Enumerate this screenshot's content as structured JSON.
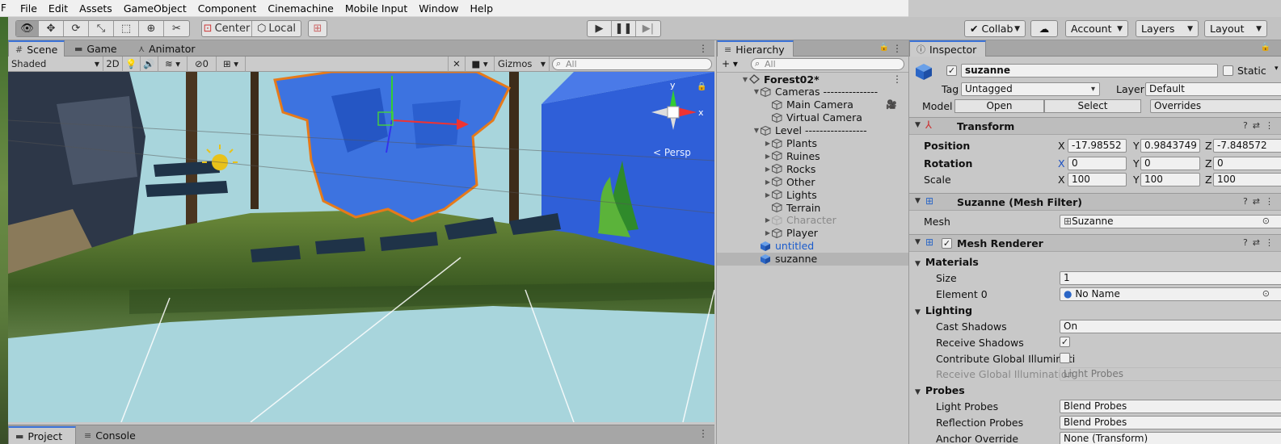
{
  "menu": {
    "leading_char": "F",
    "items": [
      "File",
      "Edit",
      "Assets",
      "GameObject",
      "Component",
      "Cinemachine",
      "Mobile Input",
      "Window",
      "Help"
    ]
  },
  "toolbar": {
    "center_label": "Center",
    "local_label": "Local",
    "collab_label": "Collab",
    "account_label": "Account",
    "layers_label": "Layers",
    "layout_label": "Layout"
  },
  "scene_tabs": {
    "scene": "Scene",
    "game": "Game",
    "animator": "Animator"
  },
  "scene_bar": {
    "shading": "Shaded",
    "mode_2d": "2D",
    "hidden_count": "0",
    "gizmos": "Gizmos",
    "search_placeholder": "All"
  },
  "viewport": {
    "gizmo_y": "y",
    "gizmo_x": "x",
    "persp_label": "< Persp"
  },
  "bottom_tabs": {
    "project": "Project",
    "console": "Console"
  },
  "hierarchy": {
    "tab_title": "Hierarchy",
    "add_label": "+ ▾",
    "search_placeholder": "All",
    "rows": [
      {
        "label": "Forest02*",
        "depth": 0,
        "arrow": "▼",
        "style": "bold"
      },
      {
        "label": "Cameras ---------------",
        "depth": 1,
        "arrow": "▼",
        "style": ""
      },
      {
        "label": "Main Camera",
        "depth": 2,
        "arrow": "",
        "style": ""
      },
      {
        "label": "Virtual Camera",
        "depth": 2,
        "arrow": "",
        "style": ""
      },
      {
        "label": "Level -----------------",
        "depth": 1,
        "arrow": "▼",
        "style": ""
      },
      {
        "label": "Plants",
        "depth": 2,
        "arrow": "▶",
        "style": ""
      },
      {
        "label": "Ruines",
        "depth": 2,
        "arrow": "▶",
        "style": ""
      },
      {
        "label": "Rocks",
        "depth": 2,
        "arrow": "▶",
        "style": ""
      },
      {
        "label": "Other",
        "depth": 2,
        "arrow": "▶",
        "style": ""
      },
      {
        "label": "Lights",
        "depth": 2,
        "arrow": "▶",
        "style": ""
      },
      {
        "label": "Terrain",
        "depth": 2,
        "arrow": "",
        "style": ""
      },
      {
        "label": "Character",
        "depth": 2,
        "arrow": "▶",
        "style": "dim"
      },
      {
        "label": "Player",
        "depth": 2,
        "arrow": "▶",
        "style": ""
      },
      {
        "label": "untitled",
        "depth": 1,
        "arrow": "",
        "style": "blue"
      },
      {
        "label": "suzanne",
        "depth": 1,
        "arrow": "",
        "style": "selected"
      }
    ]
  },
  "inspector": {
    "tab_title": "Inspector",
    "object_name": "suzanne",
    "static_label": "Static",
    "tag_label": "Tag",
    "tag_value": "Untagged",
    "layer_label": "Layer",
    "layer_value": "Default",
    "model_label": "Model",
    "open_label": "Open",
    "select_label": "Select",
    "overrides_label": "Overrides",
    "transform": {
      "title": "Transform",
      "position_label": "Position",
      "rotation_label": "Rotation",
      "scale_label": "Scale",
      "axis_x": "X",
      "axis_y": "Y",
      "axis_z": "Z",
      "position": {
        "x": "-17.98552",
        "y": "0.9843749",
        "z": "-7.848572"
      },
      "rotation": {
        "x": "0",
        "y": "0",
        "z": "0"
      },
      "scale": {
        "x": "100",
        "y": "100",
        "z": "100"
      }
    },
    "mesh_filter": {
      "title": "Suzanne (Mesh Filter)",
      "mesh_label": "Mesh",
      "mesh_value": "Suzanne"
    },
    "mesh_renderer": {
      "title": "Mesh Renderer",
      "materials_label": "Materials",
      "size_label": "Size",
      "size_value": "1",
      "element0_label": "Element 0",
      "element0_value": "No Name",
      "lighting_label": "Lighting",
      "cast_shadows_label": "Cast Shadows",
      "cast_shadows_value": "On",
      "receive_shadows_label": "Receive Shadows",
      "contribute_gi_label": "Contribute Global Illuminati",
      "receive_gi_label": "Receive Global Illumination",
      "receive_gi_value": "Light Probes",
      "probes_label": "Probes",
      "light_probes_label": "Light Probes",
      "light_probes_value": "Blend Probes",
      "reflection_probes_label": "Reflection Probes",
      "reflection_probes_value": "Blend Probes",
      "anchor_override_label": "Anchor Override",
      "anchor_override_value": "None (Transform)"
    }
  }
}
